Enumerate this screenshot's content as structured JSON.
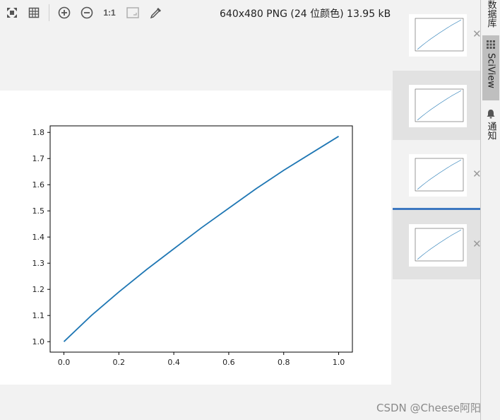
{
  "toolbar": {
    "icons": [
      "fit-screen-icon",
      "grid-icon",
      "zoom-in-icon",
      "zoom-out-icon",
      "actual-size-icon",
      "fit-window-icon",
      "color-picker-icon"
    ],
    "actual_size_label": "1:1",
    "image_info": "640x480 PNG (24 位颜色) 13.95 kB"
  },
  "side_tabs": {
    "database": "数据库",
    "sciview": "SciView",
    "notifications": "通知"
  },
  "thumbnails": {
    "count": 4,
    "selected_index": 3
  },
  "watermark": "CSDN @Cheese阿阳",
  "chart_data": {
    "type": "line",
    "x": [
      0.0,
      0.1,
      0.2,
      0.3,
      0.4,
      0.5,
      0.6,
      0.7,
      0.8,
      0.9,
      1.0
    ],
    "series": [
      {
        "values": [
          1.0,
          1.1,
          1.19,
          1.275,
          1.355,
          1.435,
          1.51,
          1.585,
          1.655,
          1.72,
          1.785
        ],
        "color": "#1f77b4"
      }
    ],
    "xticks": [
      "0.0",
      "0.2",
      "0.4",
      "0.6",
      "0.8",
      "1.0"
    ],
    "yticks": [
      "1.0",
      "1.1",
      "1.2",
      "1.3",
      "1.4",
      "1.5",
      "1.6",
      "1.7",
      "1.8"
    ],
    "xlim": [
      -0.05,
      1.05
    ],
    "ylim": [
      0.96,
      1.825
    ],
    "title": "",
    "xlabel": "",
    "ylabel": "",
    "grid": false
  }
}
